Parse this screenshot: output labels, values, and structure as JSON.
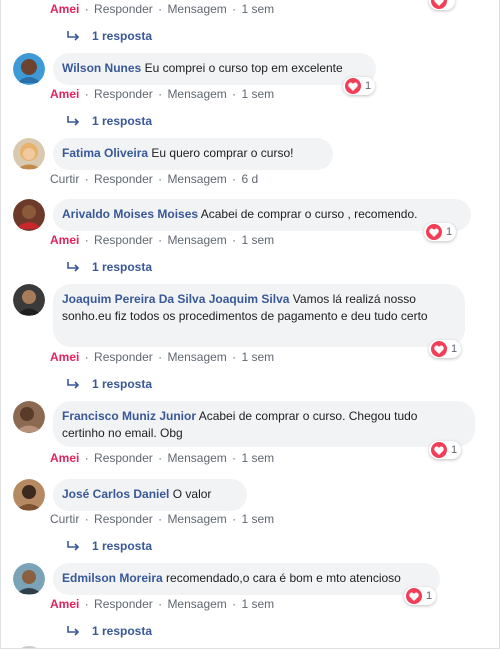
{
  "colors": {
    "link": "#385898",
    "liked": "#e0245e",
    "bubble": "#f2f3f5",
    "heart": "#f33e58"
  },
  "top": {
    "liked": "Amei",
    "reply": "Responder",
    "message": "Mensagem",
    "time": "1 sem",
    "replies": "1 resposta"
  },
  "comments": [
    {
      "author": "Wilson Nunes",
      "text": "Eu comprei o curso top em excelente",
      "like": "Amei",
      "reply": "Responder",
      "message": "Mensagem",
      "time": "1 sem",
      "reactions": "1",
      "replies": "1 resposta"
    },
    {
      "author": "Fatima Oliveira",
      "text": "Eu quero comprar o curso!",
      "like": "Curtir",
      "reply": "Responder",
      "message": "Mensagem",
      "time": "6 d"
    },
    {
      "author": "Arivaldo Moises Moises",
      "text": "Acabei de comprar o curso , recomendo.",
      "like": "Amei",
      "reply": "Responder",
      "message": "Mensagem",
      "time": "1 sem",
      "reactions": "1",
      "replies": "1 resposta"
    },
    {
      "author": "Joaquim Pereira Da Silva Joaquim Silva",
      "text": "Vamos lá realizá nosso sonho.eu fiz todos os procedimentos de pagamento e deu tudo certo",
      "like": "Amei",
      "reply": "Responder",
      "message": "Mensagem",
      "time": "1 sem",
      "reactions": "1",
      "replies": "1 resposta"
    },
    {
      "author": "Francisco Muniz Junior",
      "text": "Acabei de comprar o curso. Chegou tudo certinho no email. Obg",
      "like": "Amei",
      "reply": "Responder",
      "message": "Mensagem",
      "time": "1 sem",
      "reactions": "1"
    },
    {
      "author": "José Carlos Daniel",
      "text": "O valor",
      "like": "Curtir",
      "reply": "Responder",
      "message": "Mensagem",
      "time": "1 sem",
      "replies": "1 resposta"
    },
    {
      "author": "Edmilson Moreira",
      "text": "recomendado,o cara é bom e mto atencioso",
      "like": "Amei",
      "reply": "Responder",
      "message": "Mensagem",
      "time": "1 sem",
      "reactions": "1",
      "replies": "1 resposta"
    }
  ]
}
